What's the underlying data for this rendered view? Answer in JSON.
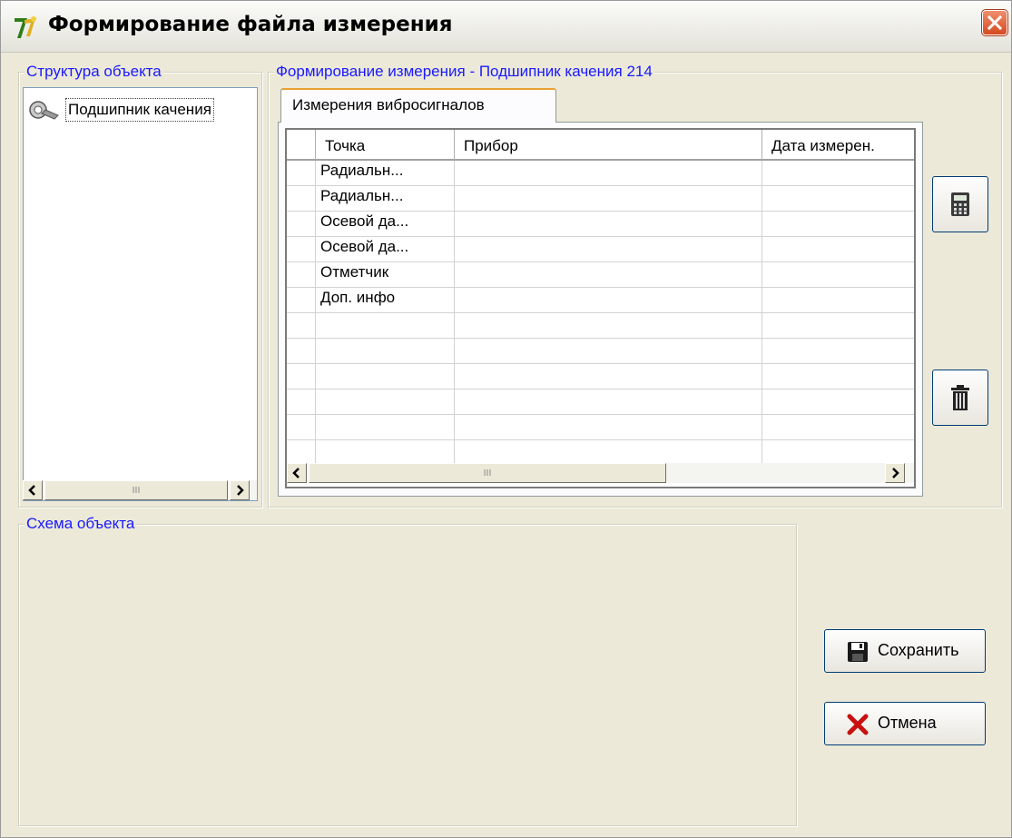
{
  "window": {
    "title": "Формирование файла измерения",
    "icon": "app-icon",
    "close": "close-icon"
  },
  "structure": {
    "legend": "Структура объекта",
    "tree_item": "Подшипник качения",
    "tree_icon": "bearing-icon",
    "scroll_thumb_grip": "III"
  },
  "measure": {
    "legend": "Формирование измерения - Подшипник качения 214",
    "tab_label": "Измерения вибросигналов",
    "columns": [
      "Точка",
      "Прибор",
      "Дата измерен."
    ],
    "rows": [
      [
        "Радиальн...",
        "",
        ""
      ],
      [
        "Радиальн...",
        "",
        ""
      ],
      [
        "Осевой да...",
        "",
        ""
      ],
      [
        "Осевой да...",
        "",
        ""
      ],
      [
        "Отметчик",
        "",
        ""
      ],
      [
        "Доп. инфо",
        "",
        ""
      ],
      [
        "",
        "",
        ""
      ],
      [
        "",
        "",
        ""
      ],
      [
        "",
        "",
        ""
      ],
      [
        "",
        "",
        ""
      ],
      [
        "",
        "",
        ""
      ],
      [
        "",
        "",
        ""
      ]
    ],
    "scroll_thumb_grip": "III",
    "calc_icon": "calculator-icon",
    "delete_icon": "trash-icon"
  },
  "scheme": {
    "legend": "Схема объекта"
  },
  "buttons": {
    "save_label": "Сохранить",
    "save_icon": "floppy-disk-icon",
    "cancel_label": "Отмена",
    "cancel_icon": "red-x-icon"
  }
}
